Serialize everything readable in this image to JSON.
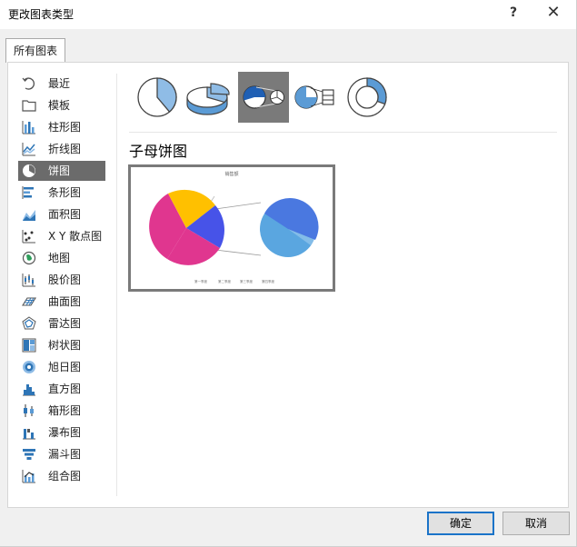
{
  "window": {
    "title": "更改图表类型",
    "help_label": "?",
    "close_label": "✕"
  },
  "tabs": [
    {
      "label": "所有图表"
    }
  ],
  "nav": {
    "items": [
      {
        "label": "最近",
        "icon": "recent-icon"
      },
      {
        "label": "模板",
        "icon": "folder-icon"
      },
      {
        "label": "柱形图",
        "icon": "column-chart-icon"
      },
      {
        "label": "折线图",
        "icon": "line-chart-icon"
      },
      {
        "label": "饼图",
        "icon": "pie-chart-icon",
        "selected": true
      },
      {
        "label": "条形图",
        "icon": "bar-chart-icon"
      },
      {
        "label": "面积图",
        "icon": "area-chart-icon"
      },
      {
        "label": "X Y 散点图",
        "icon": "scatter-chart-icon"
      },
      {
        "label": "地图",
        "icon": "map-chart-icon"
      },
      {
        "label": "股价图",
        "icon": "stock-chart-icon"
      },
      {
        "label": "曲面图",
        "icon": "surface-chart-icon"
      },
      {
        "label": "雷达图",
        "icon": "radar-chart-icon"
      },
      {
        "label": "树状图",
        "icon": "treemap-chart-icon"
      },
      {
        "label": "旭日图",
        "icon": "sunburst-chart-icon"
      },
      {
        "label": "直方图",
        "icon": "histogram-chart-icon"
      },
      {
        "label": "箱形图",
        "icon": "box-whisker-chart-icon"
      },
      {
        "label": "瀑布图",
        "icon": "waterfall-chart-icon"
      },
      {
        "label": "漏斗图",
        "icon": "funnel-chart-icon"
      },
      {
        "label": "组合图",
        "icon": "combo-chart-icon"
      }
    ]
  },
  "chart_types": [
    {
      "name": "pie",
      "icon": "pie-type-icon"
    },
    {
      "name": "3d-pie",
      "icon": "3d-pie-type-icon"
    },
    {
      "name": "pie-of-pie",
      "icon": "pie-of-pie-type-icon",
      "selected": true
    },
    {
      "name": "bar-of-pie",
      "icon": "bar-of-pie-type-icon"
    },
    {
      "name": "doughnut",
      "icon": "doughnut-type-icon"
    }
  ],
  "selected_type_label": "子母饼图",
  "preview": {
    "title": "销售额",
    "legend": [
      "第一季度",
      "第二季度",
      "第三季度",
      "第四季度"
    ]
  },
  "buttons": {
    "ok": "确定",
    "cancel": "取消"
  },
  "colors": {
    "accent": "#1a73c8",
    "selected_bg": "#6b6b6b",
    "icon_blue": "#5b9bd5"
  }
}
